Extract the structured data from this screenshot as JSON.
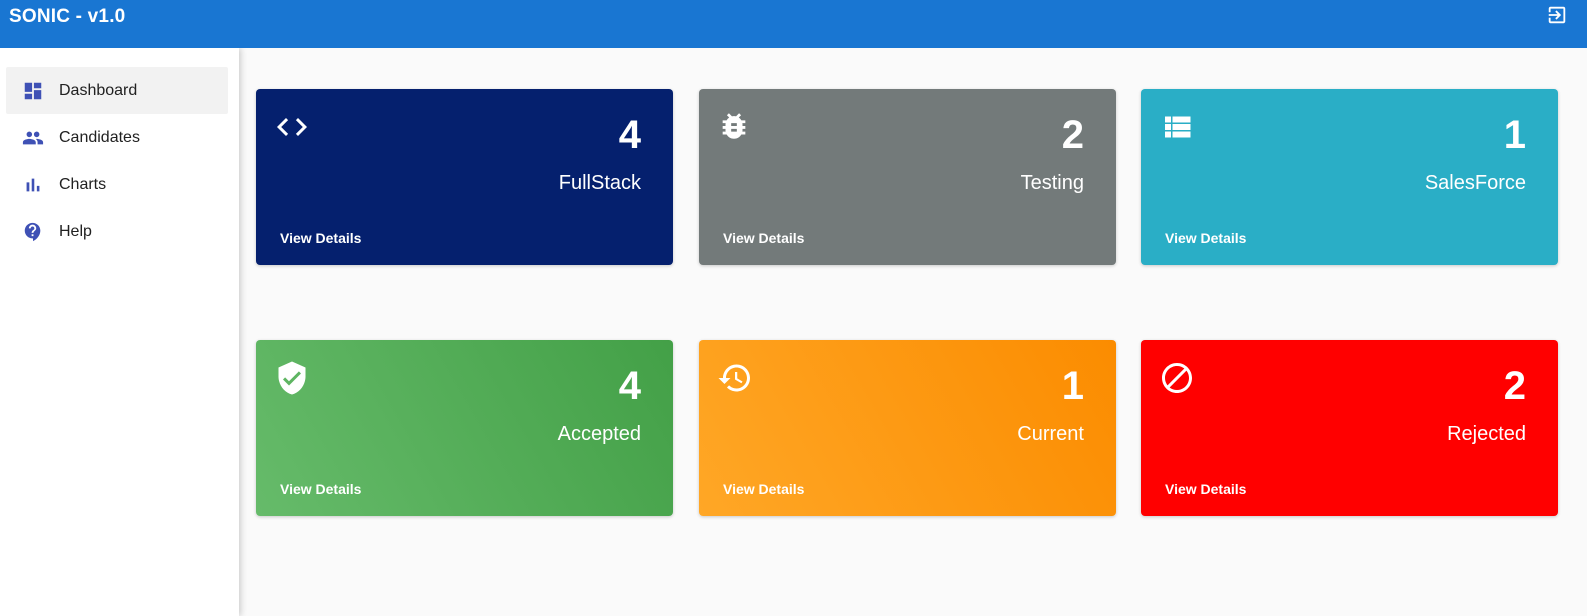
{
  "app": {
    "title": "SONIC - v1.0"
  },
  "sidebar": {
    "items": [
      {
        "label": "Dashboard",
        "icon": "dashboard-icon",
        "active": true
      },
      {
        "label": "Candidates",
        "icon": "people-icon"
      },
      {
        "label": "Charts",
        "icon": "bar-chart-icon"
      },
      {
        "label": "Help",
        "icon": "help-icon"
      }
    ]
  },
  "cards": [
    {
      "count": "4",
      "label": "FullStack",
      "link": "View Details",
      "icon": "code-icon",
      "color": "#05206e"
    },
    {
      "count": "2",
      "label": "Testing",
      "link": "View Details",
      "icon": "bug-icon",
      "color": "#737a7a"
    },
    {
      "count": "1",
      "label": "SalesForce",
      "link": "View Details",
      "icon": "list-icon",
      "color": "#2aaec6"
    },
    {
      "count": "4",
      "label": "Accepted",
      "link": "View Details",
      "icon": "verified-shield-icon",
      "color": "#4caf50"
    },
    {
      "count": "1",
      "label": "Current",
      "link": "View Details",
      "icon": "history-icon",
      "color": "#ff9800"
    },
    {
      "count": "2",
      "label": "Rejected",
      "link": "View Details",
      "icon": "block-icon",
      "color": "#ff0000"
    }
  ]
}
